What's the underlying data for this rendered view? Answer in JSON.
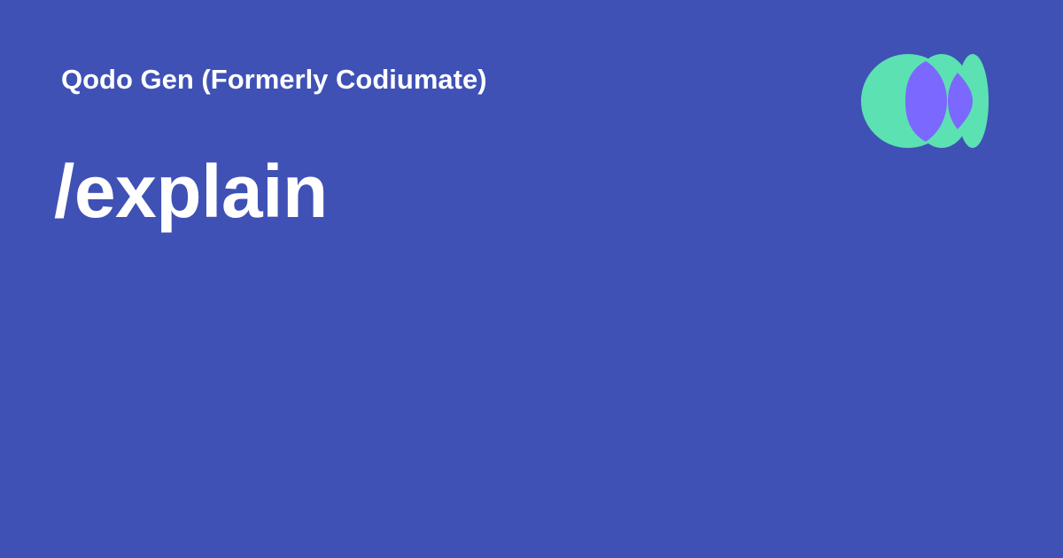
{
  "page": {
    "background_color": "#3F51B5",
    "product_name": "Qodo Gen (Formerly Codiumate)",
    "command": "/explain"
  },
  "logo": {
    "icon": "qodo-logo-icon",
    "colors": {
      "green": "#5CE1B2",
      "purple": "#7B68FF"
    }
  }
}
